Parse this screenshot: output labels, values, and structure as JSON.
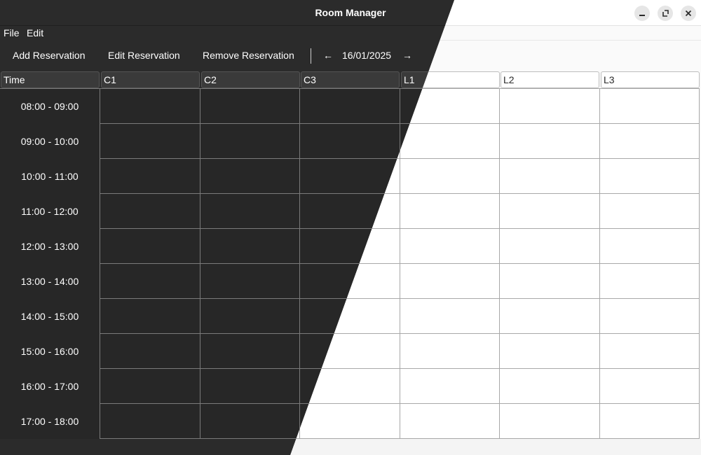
{
  "window": {
    "title": "Room Manager"
  },
  "menu": {
    "file": "File",
    "edit": "Edit"
  },
  "toolbar": {
    "add": "Add Reservation",
    "edit": "Edit Reservation",
    "remove": "Remove Reservation",
    "prev": "←",
    "date": "16/01/2025",
    "next": "→"
  },
  "table": {
    "columns": [
      "Time",
      "C1",
      "C2",
      "C3",
      "L1",
      "L2",
      "L3"
    ],
    "rows": [
      "08:00 - 09:00",
      "09:00 - 10:00",
      "10:00 - 11:00",
      "11:00 - 12:00",
      "12:00 - 13:00",
      "13:00 - 14:00",
      "14:00 - 15:00",
      "15:00 - 16:00",
      "16:00 - 17:00",
      "17:00 - 18:00"
    ]
  },
  "icons": {
    "minimize": "minimize-icon",
    "maximize": "maximize-icon",
    "close": "close-icon"
  },
  "colors": {
    "dark_bg": "#2b2b2b",
    "light_bg": "#fafafa",
    "grid_dark": "#7a7a7a",
    "grid_light": "#a8a8a8"
  }
}
